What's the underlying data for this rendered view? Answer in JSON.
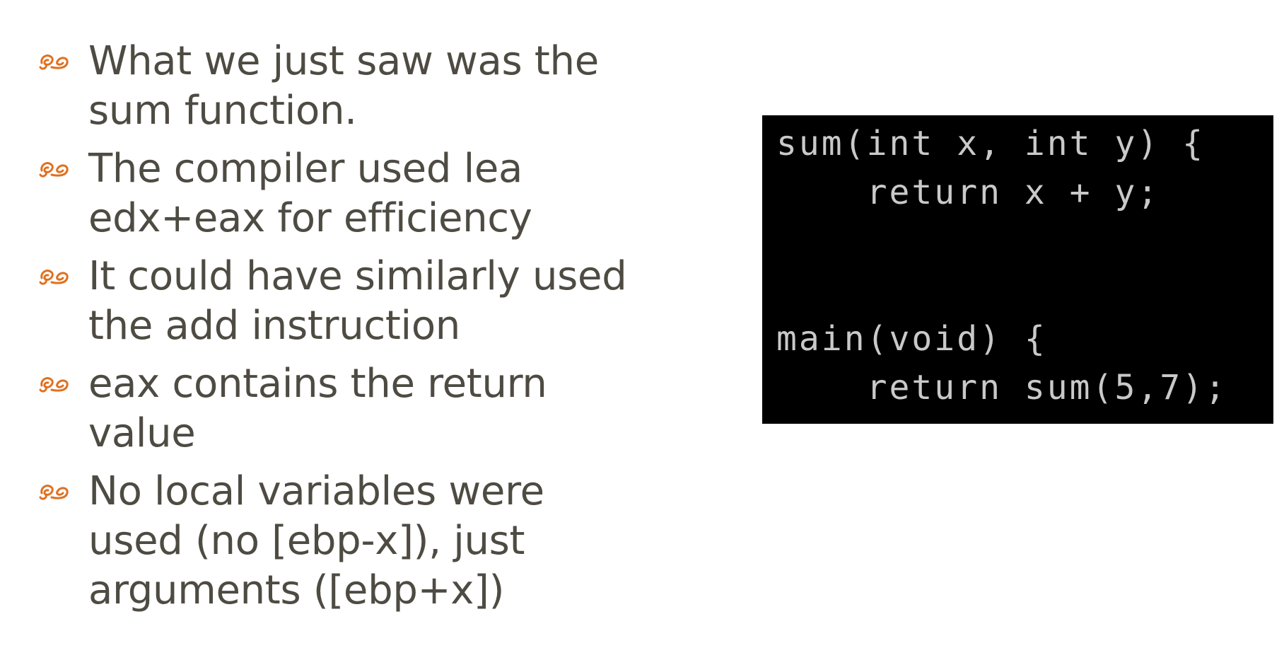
{
  "slide": {
    "bullet_icon": "fleuron-bullet-icon",
    "accent_color": "#e0701f",
    "text_color": "#4e4b43",
    "bullets": [
      {
        "text": "What we just saw was the sum function."
      },
      {
        "text": "The compiler used lea edx+eax for efficiency"
      },
      {
        "text": "It could have similarly used the add instruction"
      },
      {
        "text": "eax contains the return value"
      },
      {
        "text": "No local variables were used (no [ebp-x]), just arguments ([ebp+x])"
      }
    ]
  },
  "code": {
    "background": "#000000",
    "text_color": "#c9c9c9",
    "lines": [
      "sum(int x, int y) {",
      "    return x + y;",
      "",
      "",
      "main(void) {",
      "    return sum(5,7);"
    ]
  }
}
